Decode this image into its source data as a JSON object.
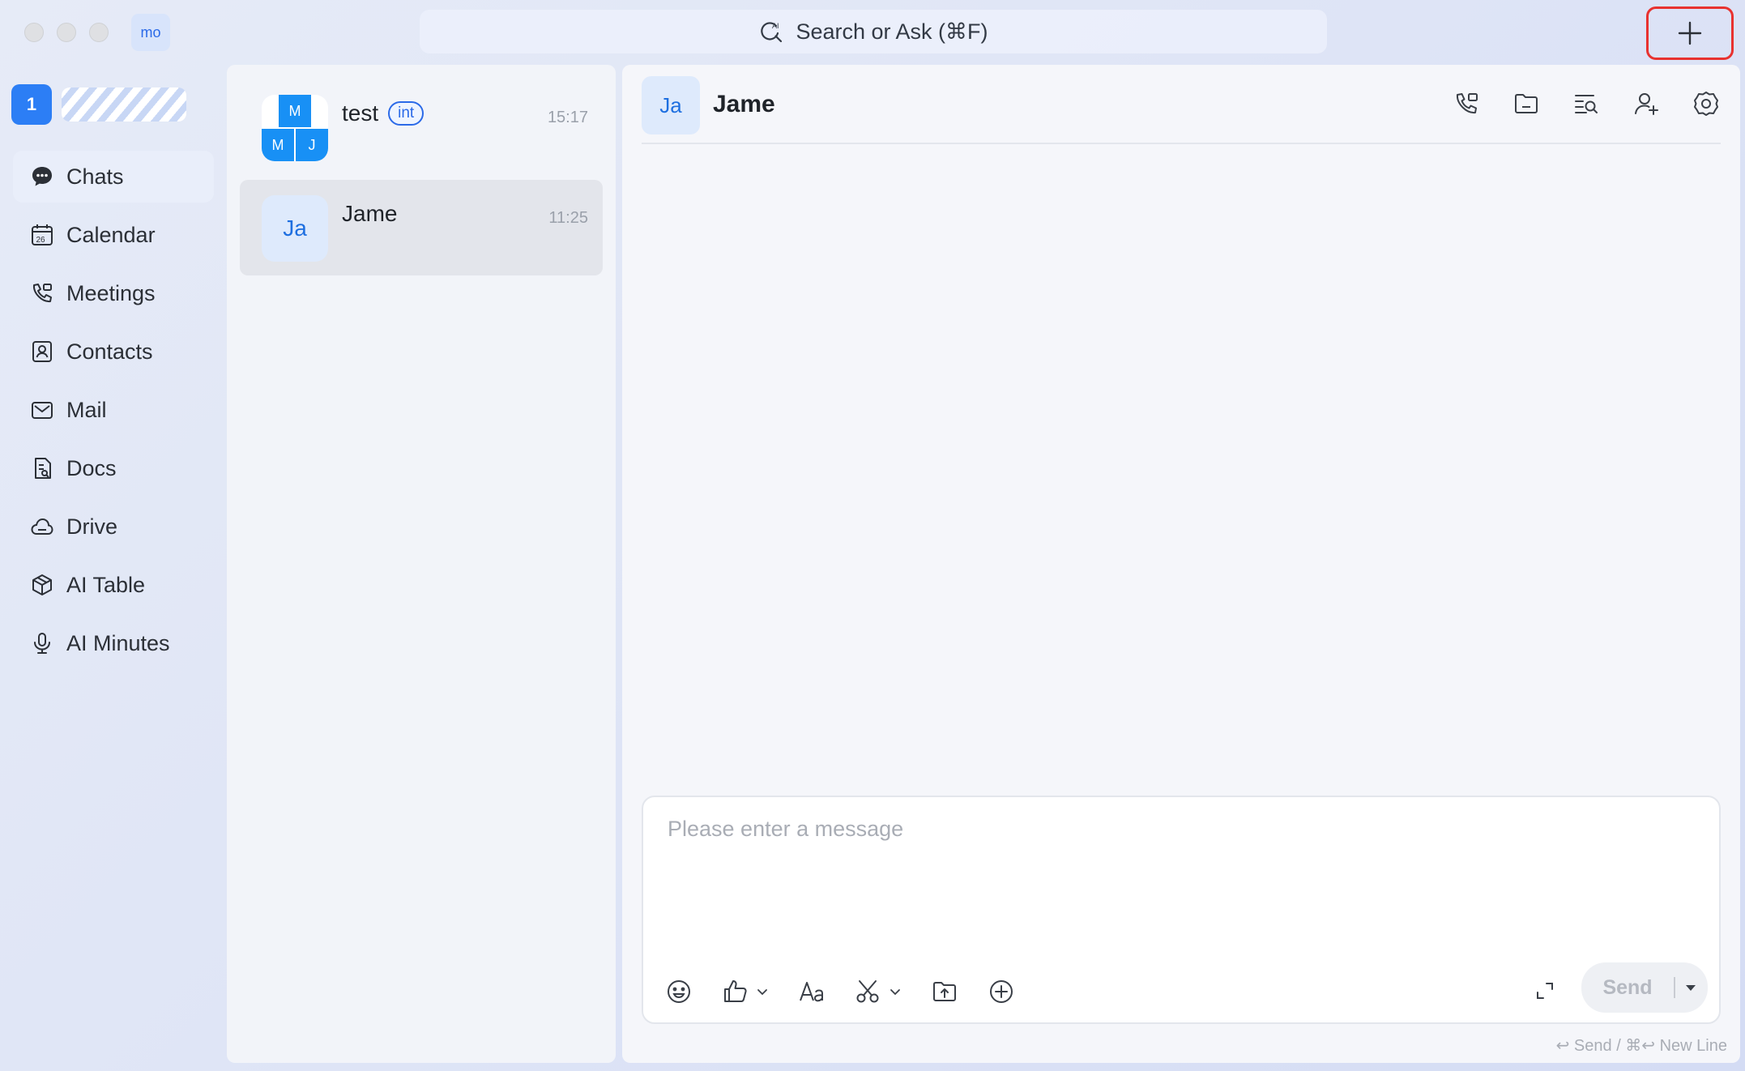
{
  "window": {
    "tenant_badge": "mo",
    "search_placeholder": "Search or Ask  (⌘F)"
  },
  "profile": {
    "unread_count": "1"
  },
  "nav": {
    "items": [
      {
        "label": "Chats",
        "icon": "chat-bubble-icon",
        "active": true
      },
      {
        "label": "Calendar",
        "icon": "calendar-icon"
      },
      {
        "label": "Meetings",
        "icon": "meeting-phone-icon"
      },
      {
        "label": "Contacts",
        "icon": "contacts-icon"
      },
      {
        "label": "Mail",
        "icon": "mail-icon"
      },
      {
        "label": "Docs",
        "icon": "docs-icon"
      },
      {
        "label": "Drive",
        "icon": "cloud-drive-icon"
      },
      {
        "label": "AI Table",
        "icon": "ai-table-icon"
      },
      {
        "label": "AI Minutes",
        "icon": "microphone-icon"
      }
    ]
  },
  "chats": [
    {
      "name": "test",
      "tag": "int",
      "time": "15:17",
      "avatar_cells": [
        "M",
        "M",
        "J"
      ],
      "selected": false
    },
    {
      "name": "Jame",
      "time": "11:25",
      "avatar": "Ja",
      "selected": true
    }
  ],
  "conversation": {
    "avatar": "Ja",
    "title": "Jame",
    "header_actions": [
      "call-icon",
      "folder-icon",
      "search-history-icon",
      "add-member-icon",
      "settings-gear-icon"
    ],
    "composer": {
      "placeholder": "Please enter a message",
      "value": "",
      "tools": [
        "emoji-icon",
        "thumbs-up-icon",
        "text-format-icon",
        "scissors-screenshot-icon",
        "upload-file-icon",
        "plus-circle-icon"
      ],
      "send_label": "Send",
      "hint": "↩ Send / ⌘↩ New Line"
    }
  },
  "colors": {
    "accent": "#2c7ef5",
    "highlight_border": "#e8322f",
    "group_avatar": "#1890f5"
  }
}
